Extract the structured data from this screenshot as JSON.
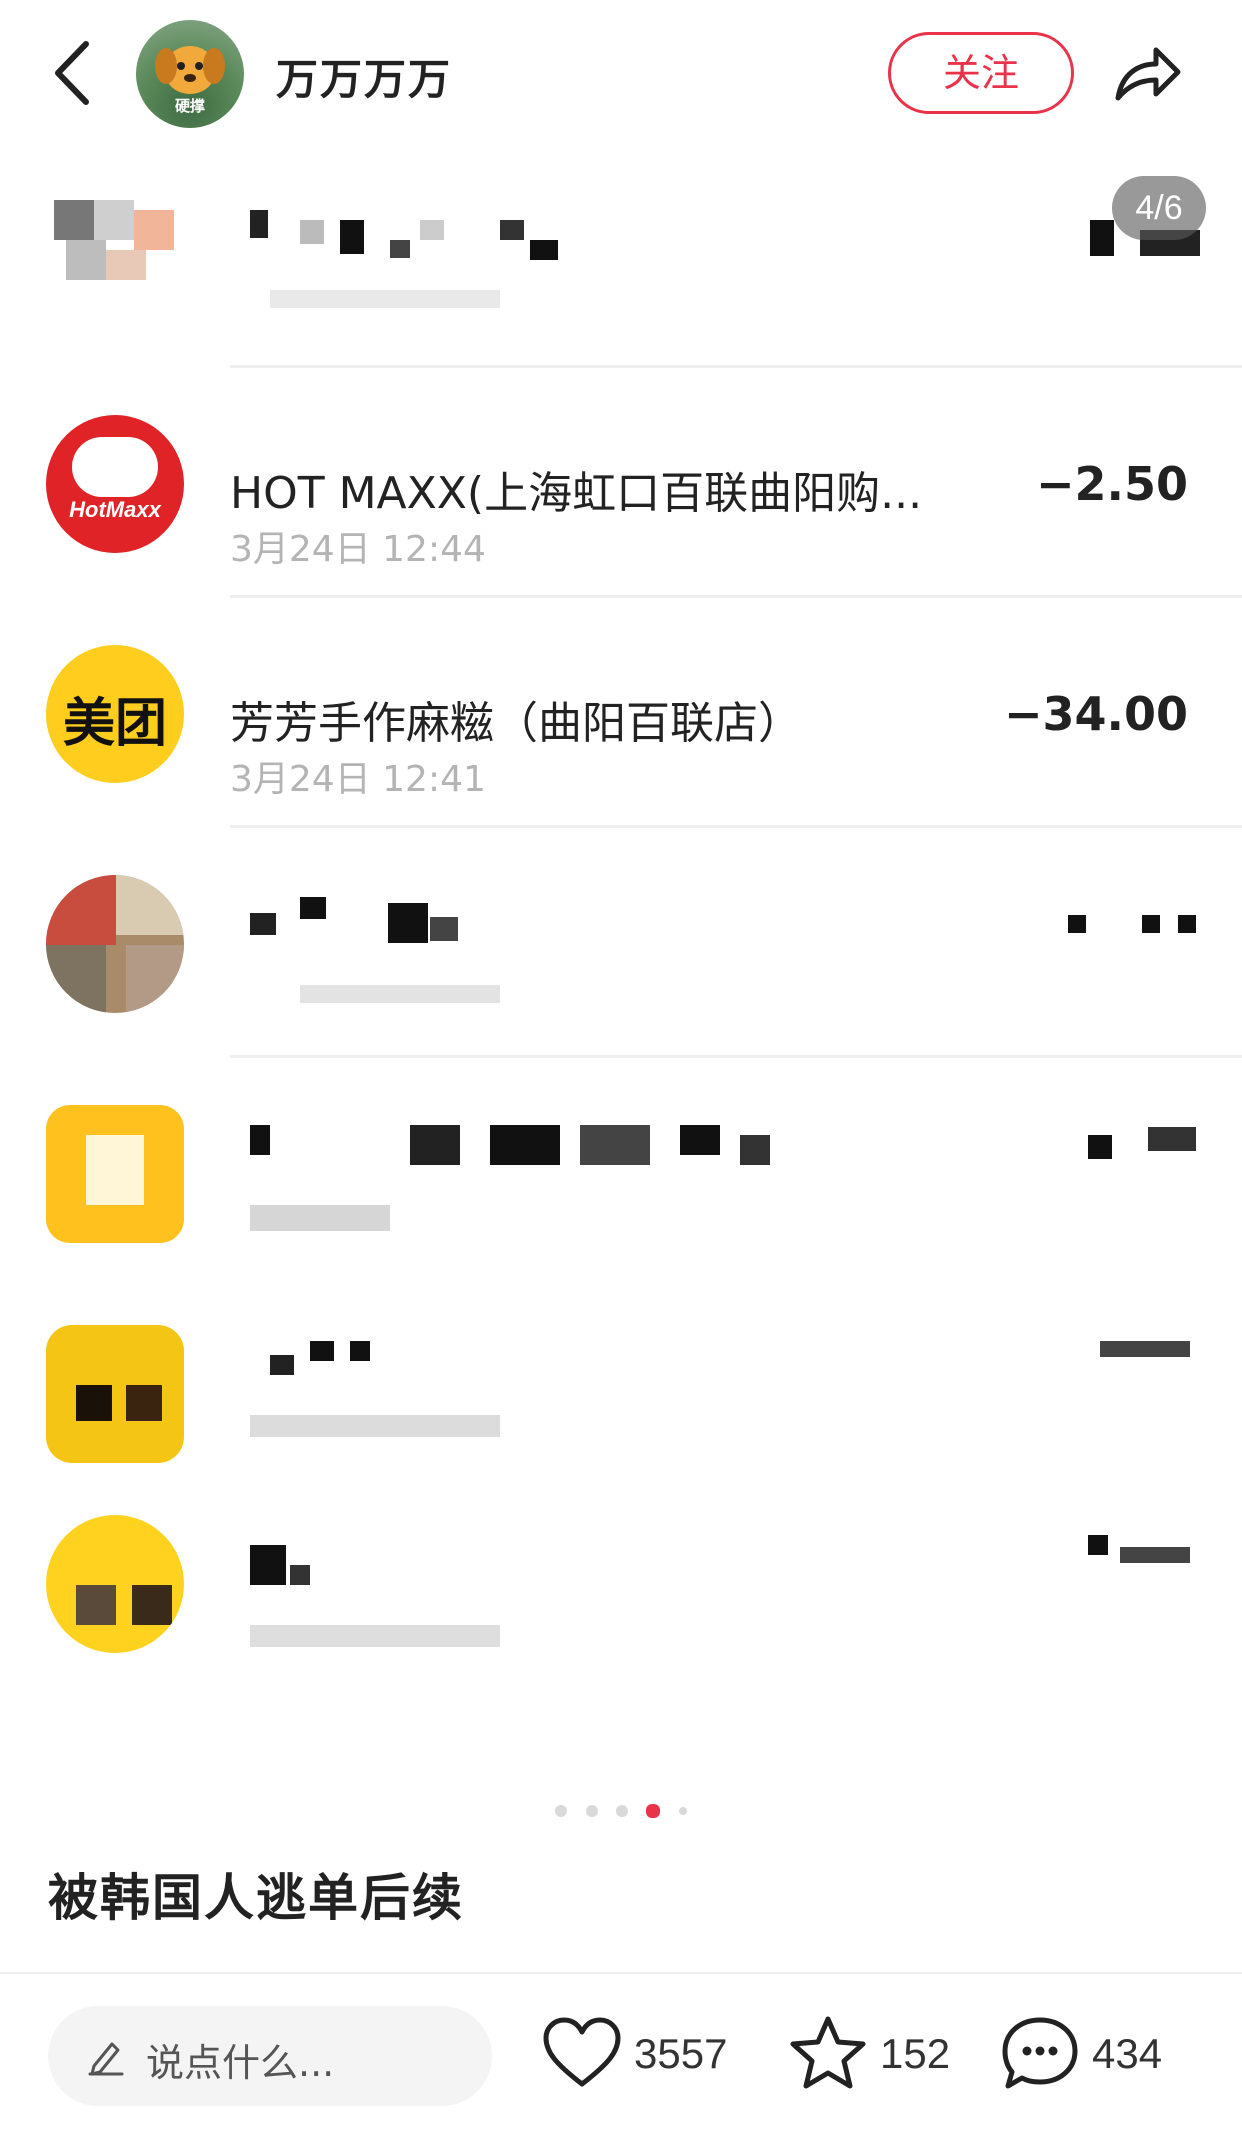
{
  "header": {
    "username": "万万万万",
    "avatar_tag": "硬撑",
    "follow_label": "关注"
  },
  "carousel": {
    "counter": "4/6",
    "page_count": 5,
    "active_page": 4
  },
  "transactions": [
    {
      "title": "HOT MAXX(上海虹口百联曲阳购...",
      "time": "3月24日 12:44",
      "amount": "−2.50",
      "logo_text": "HotMaxx"
    },
    {
      "title": "芳芳手作麻糍（曲阳百联店）",
      "time": "3月24日 12:41",
      "amount": "−34.00",
      "logo_text": "美团"
    }
  ],
  "post": {
    "caption": "被韩国人逃单后续"
  },
  "bottom_bar": {
    "comment_placeholder": "说点什么...",
    "likes": "3557",
    "stars": "152",
    "comments": "434"
  },
  "colors": {
    "accent": "#e8334a",
    "hotmaxx_red": "#e02326",
    "meituan_yellow": "#ffcd1d"
  },
  "icons": [
    "back-arrow-icon",
    "share-icon",
    "pencil-icon",
    "heart-icon",
    "star-icon",
    "comment-bubble-icon"
  ]
}
